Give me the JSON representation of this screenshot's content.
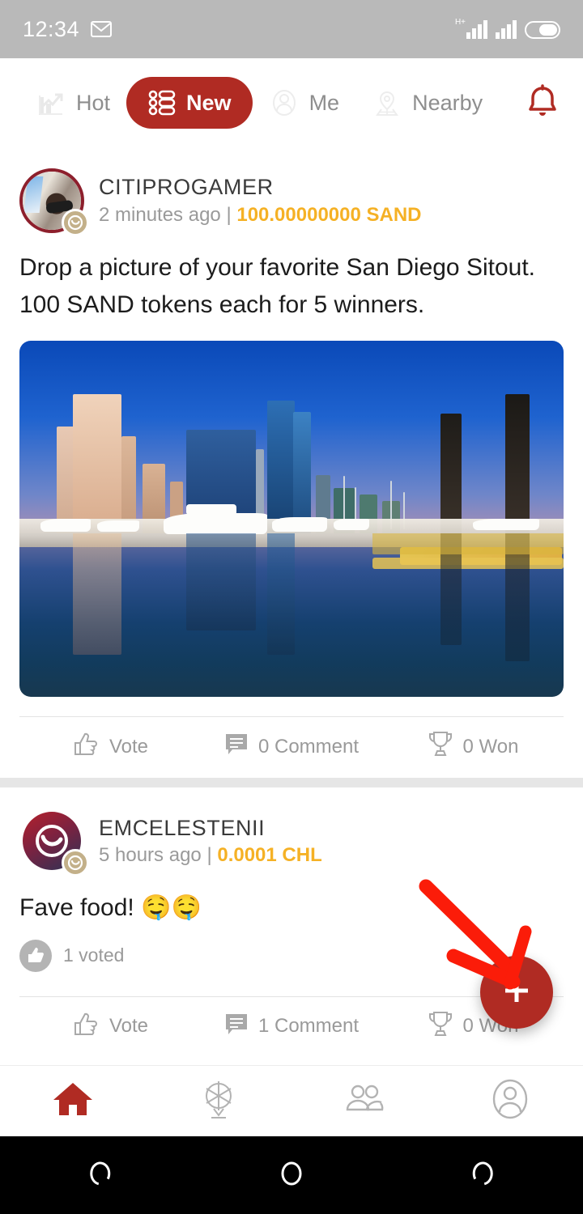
{
  "status_bar": {
    "time": "12:34",
    "mail_icon": "gmail-icon",
    "signal_label": "H+",
    "battery_icon": "battery-icon"
  },
  "header": {
    "tabs": [
      {
        "label": "Hot",
        "icon": "chart-up-icon",
        "active": false
      },
      {
        "label": "New",
        "icon": "list-icon",
        "active": true
      },
      {
        "label": "Me",
        "icon": "person-icon",
        "active": false
      },
      {
        "label": "Nearby",
        "icon": "map-pin-icon",
        "active": false
      }
    ],
    "notification_icon": "bell-icon"
  },
  "colors": {
    "brand_red": "#b02b23",
    "token_gold": "#f5b125",
    "muted_gray": "#9a9a9a",
    "status_bar_bg": "#b9b9b9"
  },
  "feed": {
    "posts": [
      {
        "username": "CITIPROGAMER",
        "timestamp": "2 minutes ago",
        "separator": "|",
        "reward": "100.00000000 SAND",
        "body": "Drop a picture of your favorite San Diego Sitout.\n100 SAND tokens each for 5 winners.",
        "body_line1": "Drop a picture of your favorite San Diego Sitout.",
        "body_line2": "100 SAND tokens each for 5 winners.",
        "has_image": true,
        "image_alt": "San Diego skyline and marina at dusk reflected in the bay",
        "voted_summary": "",
        "actions": [
          {
            "label": "Vote",
            "icon": "thumbs-up-icon"
          },
          {
            "label": "0 Comment",
            "icon": "comment-icon"
          },
          {
            "label": "0 Won",
            "icon": "trophy-icon"
          }
        ]
      },
      {
        "username": "EMCELESTENII",
        "timestamp": "5 hours ago",
        "separator": "|",
        "reward": "0.0001 CHL",
        "body_line1": "Fave food! 🤤🤤",
        "body_text": "Fave food!",
        "body_emoji": "🤤🤤",
        "has_image": false,
        "voted_summary": "1 voted",
        "voted_icon": "thumbs-up-filled-icon",
        "actions": [
          {
            "label": "Vote",
            "icon": "thumbs-up-icon"
          },
          {
            "label": "1 Comment",
            "icon": "comment-icon"
          },
          {
            "label": "0 Won",
            "icon": "trophy-icon"
          }
        ]
      }
    ]
  },
  "fab": {
    "label": "+",
    "icon": "plus-icon"
  },
  "annotation": {
    "icon": "red-arrow-annotation",
    "points_to": "fab"
  },
  "bottom_nav": {
    "items": [
      {
        "icon": "home-icon",
        "active": true
      },
      {
        "icon": "wheel-icon",
        "active": false
      },
      {
        "icon": "people-icon",
        "active": false
      },
      {
        "icon": "profile-icon",
        "active": false
      }
    ]
  },
  "android_nav": {
    "buttons": [
      {
        "icon": "back-icon"
      },
      {
        "icon": "home-circle-icon"
      },
      {
        "icon": "recents-icon"
      }
    ]
  }
}
